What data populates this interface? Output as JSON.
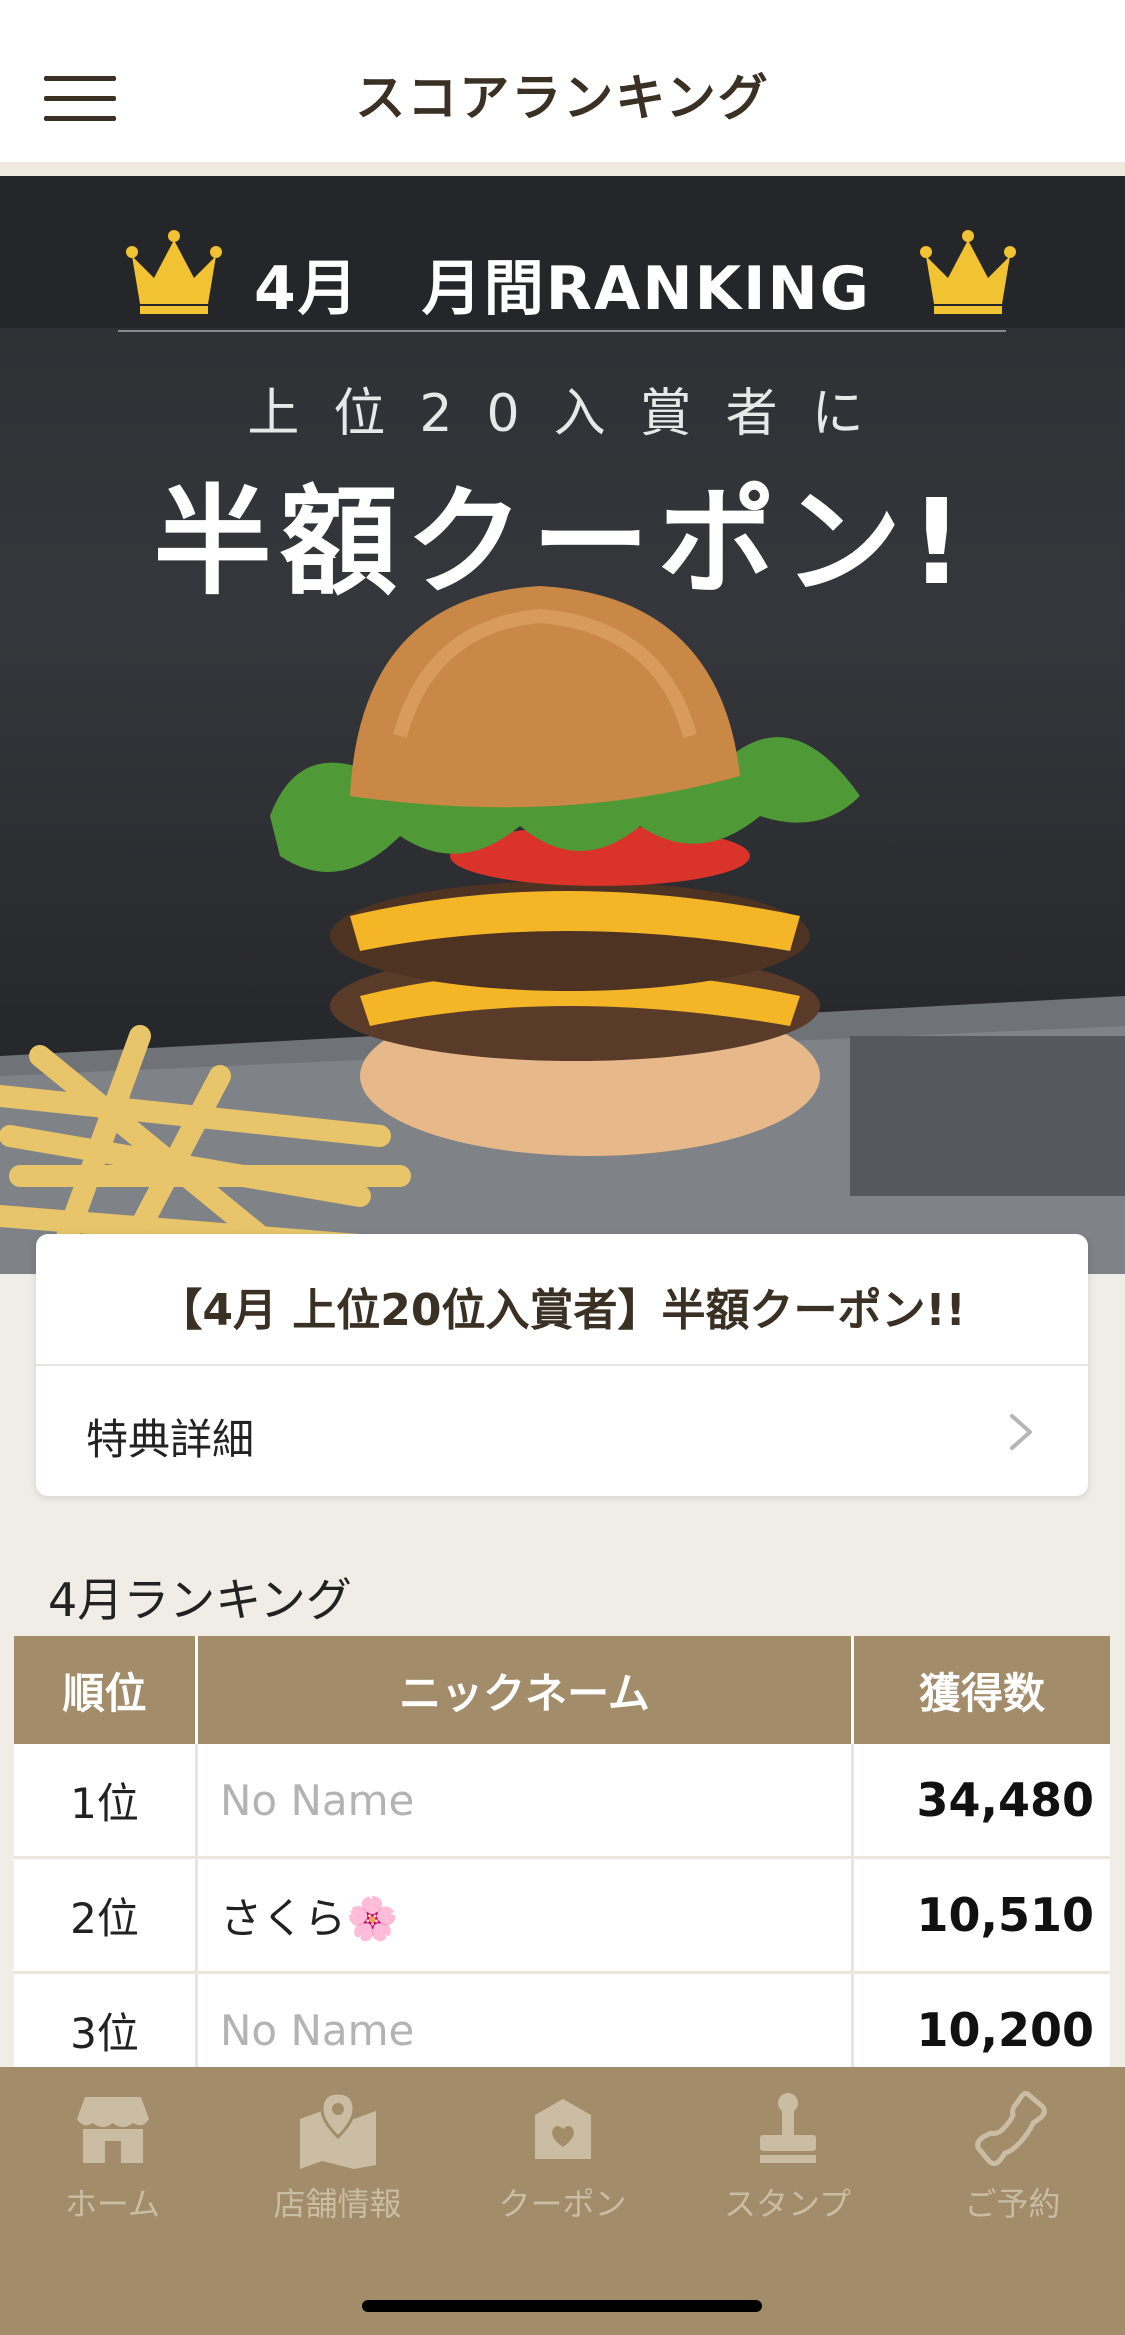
{
  "header": {
    "title": "スコアランキング"
  },
  "banner": {
    "ranking_title": "4月　月間RANKING",
    "subtitle": "上位20入賞者に",
    "headline": "半額クーポン!"
  },
  "card": {
    "title": "【4月 上位20位入賞者】半額クーポン!!",
    "link_label": "特典詳細"
  },
  "ranking": {
    "heading": "4月ランキング",
    "columns": [
      "順位",
      "ニックネーム",
      "獲得数"
    ],
    "rows": [
      {
        "rank": "1位",
        "name": "No Name",
        "score": "34,480"
      },
      {
        "rank": "2位",
        "name": "さくら🌸",
        "score": "10,510"
      },
      {
        "rank": "3位",
        "name": "No Name",
        "score": "10,200"
      }
    ]
  },
  "tabbar": {
    "items": [
      {
        "label": "ホーム",
        "icon": "store-icon"
      },
      {
        "label": "店舗情報",
        "icon": "map-pin-icon"
      },
      {
        "label": "クーポン",
        "icon": "coupon-box-icon"
      },
      {
        "label": "スタンプ",
        "icon": "stamp-icon"
      },
      {
        "label": "ご予約",
        "icon": "phone-icon"
      }
    ]
  },
  "colors": {
    "brand": "#a28c6a",
    "header_text": "#3a3024",
    "crown": "#f1c232"
  }
}
